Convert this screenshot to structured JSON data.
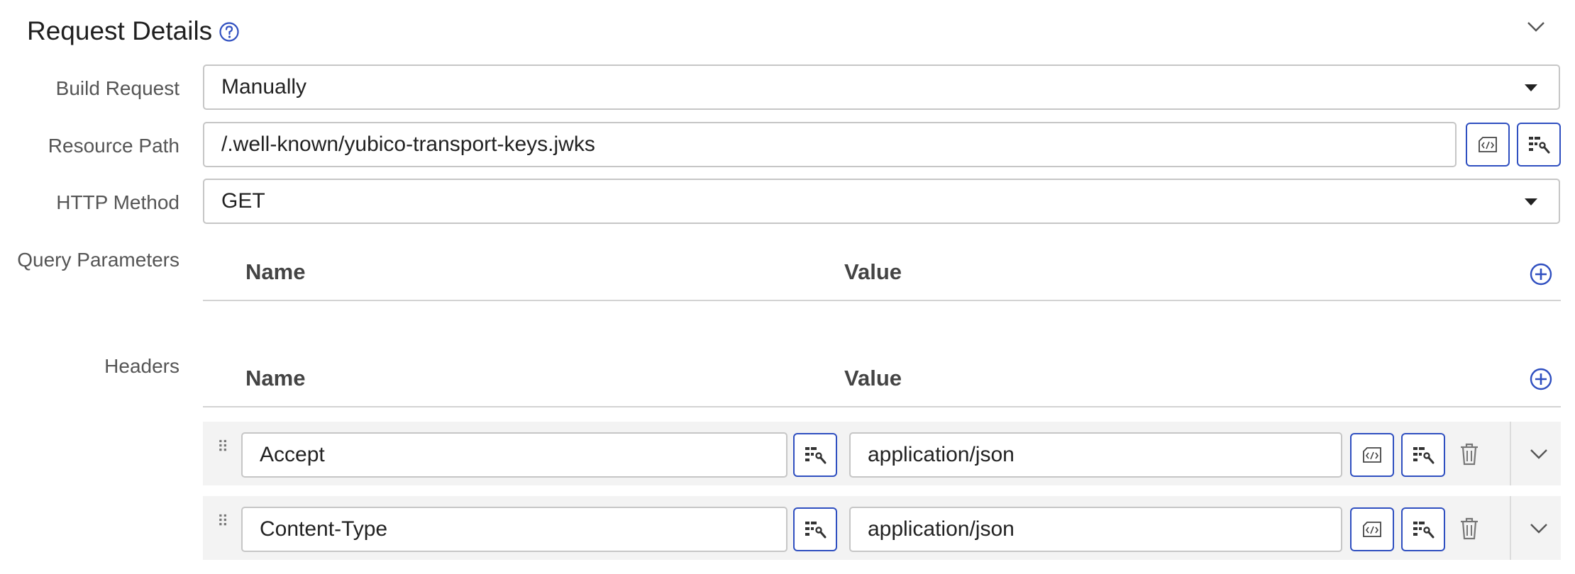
{
  "section": {
    "title": "Request Details"
  },
  "fields": {
    "build_request": {
      "label": "Build Request",
      "value": "Manually"
    },
    "resource_path": {
      "label": "Resource Path",
      "value": "/.well-known/yubico-transport-keys.jwks"
    },
    "http_method": {
      "label": "HTTP Method",
      "value": "GET"
    }
  },
  "query_parameters": {
    "label": "Query Parameters",
    "columns": {
      "name": "Name",
      "value": "Value"
    },
    "rows": []
  },
  "headers": {
    "label": "Headers",
    "columns": {
      "name": "Name",
      "value": "Value"
    },
    "rows": [
      {
        "name": "Accept",
        "value": "application/json"
      },
      {
        "name": "Content-Type",
        "value": "application/json"
      }
    ]
  },
  "icons": {
    "help": "help-circle-icon",
    "collapse": "chevron-down-icon",
    "expression": "expression-editor-icon",
    "variable": "variable-picker-icon",
    "add": "add-circle-icon",
    "delete": "trash-icon",
    "drag": "drag-handle-icon",
    "expand": "chevron-down-icon"
  },
  "colors": {
    "accent": "#2f4fc0",
    "row_bg": "#f3f3f3",
    "border": "#c6c6c6"
  }
}
